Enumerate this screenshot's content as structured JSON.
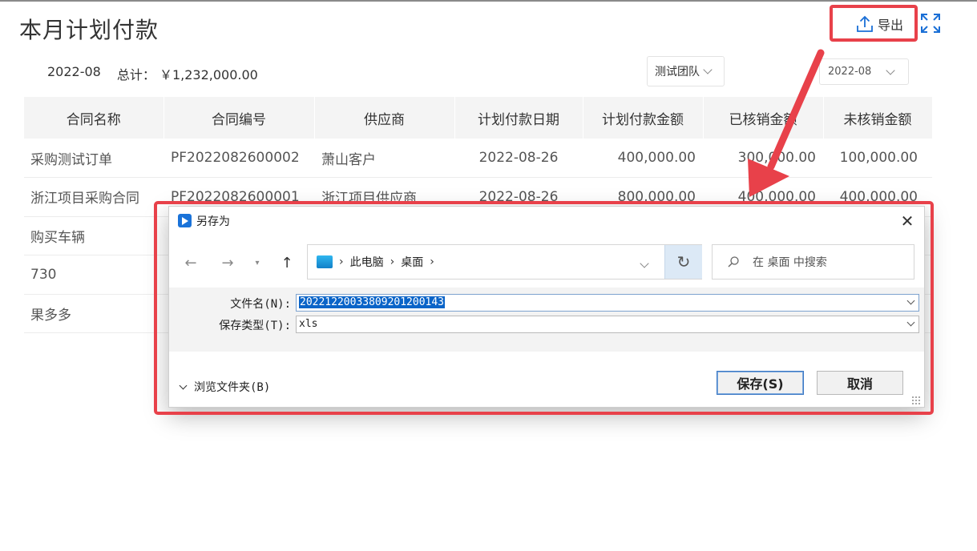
{
  "page": {
    "title": "本月计划付款",
    "export_label": "导出",
    "summary": {
      "month": "2022-08",
      "total_label": "总计：",
      "total_value": "￥1,232,000.00"
    },
    "filters": {
      "team": "测试团队",
      "month": "2022-08"
    }
  },
  "table": {
    "headers": [
      "合同名称",
      "合同编号",
      "供应商",
      "计划付款日期",
      "计划付款金额",
      "已核销金额",
      "未核销金额"
    ],
    "rows": [
      [
        "采购测试订单",
        "PF2022082600002",
        "萧山客户",
        "2022-08-26",
        "400,000.00",
        "300,000.00",
        "100,000.00"
      ],
      [
        "浙江项目采购合同",
        "PF2022082600001",
        "浙江项目供应商",
        "2022-08-26",
        "800,000.00",
        "400,000.00",
        "400,000.00"
      ],
      [
        "购买车辆",
        "",
        "",
        "",
        "",
        "",
        ""
      ],
      [
        "730",
        "",
        "",
        "",
        "",
        "",
        ""
      ],
      [
        "果多多",
        "",
        "",
        "",
        "",
        "",
        ""
      ]
    ]
  },
  "dialog": {
    "title": "另存为",
    "breadcrumb": [
      "此电脑",
      "桌面"
    ],
    "search_placeholder": "在 桌面 中搜索",
    "filename_label": "文件名(N):",
    "filename_value": "20221220033809201200143",
    "filetype_label": "保存类型(T):",
    "filetype_value": "xls",
    "browse_label": "浏览文件夹(B)",
    "save_label": "保存(S)",
    "cancel_label": "取消"
  },
  "annotation_color": "#e8414a"
}
